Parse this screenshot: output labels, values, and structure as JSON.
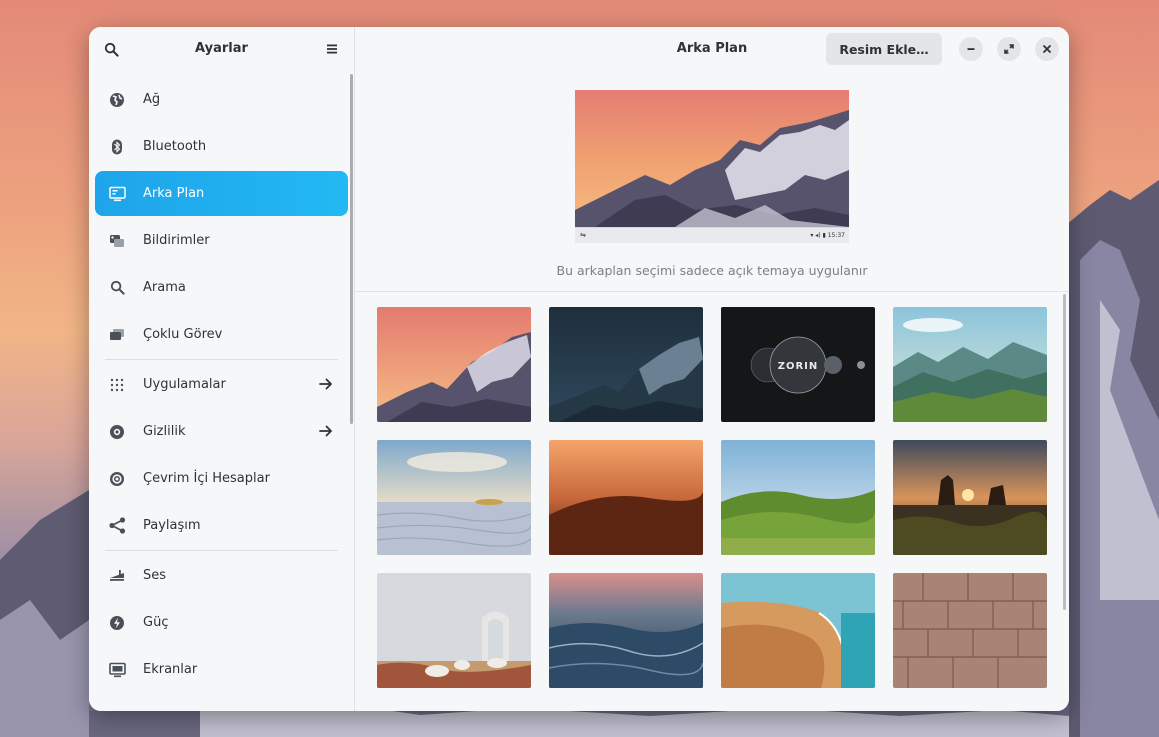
{
  "sidebar": {
    "title": "Ayarlar",
    "items": [
      {
        "label": "Ağ",
        "icon": "globe-icon"
      },
      {
        "label": "Bluetooth",
        "icon": "bluetooth-icon"
      },
      {
        "label": "Arka Plan",
        "icon": "display-background-icon",
        "active": true
      },
      {
        "label": "Bildirimler",
        "icon": "notifications-icon"
      },
      {
        "label": "Arama",
        "icon": "search-icon"
      },
      {
        "label": "Çoklu Görev",
        "icon": "multitasking-icon"
      },
      {
        "label": "Uygulamalar",
        "icon": "apps-grid-icon",
        "has_arrow": true
      },
      {
        "label": "Gizlilik",
        "icon": "privacy-icon",
        "has_arrow": true
      },
      {
        "label": "Çevrim İçi Hesaplar",
        "icon": "online-accounts-icon"
      },
      {
        "label": "Paylaşım",
        "icon": "share-icon"
      },
      {
        "label": "Ses",
        "icon": "sound-icon"
      },
      {
        "label": "Güç",
        "icon": "power-icon"
      },
      {
        "label": "Ekranlar",
        "icon": "displays-icon"
      }
    ]
  },
  "header": {
    "title": "Arka Plan",
    "add_button": "Resim Ekle…"
  },
  "preview": {
    "clock": "15:37"
  },
  "note": "Bu arkaplan seçimi sadece açık temaya uygulanır",
  "wallpapers": [
    {
      "name": "wallpaper-mountain-sunset"
    },
    {
      "name": "wallpaper-mountain-night"
    },
    {
      "name": "wallpaper-zorin-logo",
      "label": "ZORIN"
    },
    {
      "name": "wallpaper-green-valley"
    },
    {
      "name": "wallpaper-white-sands"
    },
    {
      "name": "wallpaper-orange-dune"
    },
    {
      "name": "wallpaper-green-hills"
    },
    {
      "name": "wallpaper-monument-valley"
    },
    {
      "name": "wallpaper-desert-arch"
    },
    {
      "name": "wallpaper-ocean-wave"
    },
    {
      "name": "wallpaper-coast-dunes"
    },
    {
      "name": "wallpaper-stone-wall"
    }
  ],
  "colors": {
    "accent": "#1ea4ea",
    "window_bg": "#f6f7f9"
  }
}
